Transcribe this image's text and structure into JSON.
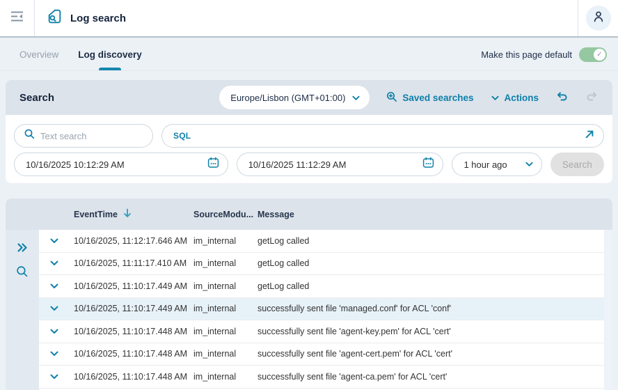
{
  "header": {
    "title": "Log search"
  },
  "tabs": [
    {
      "label": "Overview",
      "active": false
    },
    {
      "label": "Log discovery",
      "active": true
    }
  ],
  "page_default_toggle": {
    "label": "Make this page default",
    "state": "on",
    "check_glyph": "✓"
  },
  "search_panel": {
    "title": "Search",
    "timezone": "Europe/Lisbon (GMT+01:00)",
    "saved_searches_label": "Saved searches",
    "actions_label": "Actions",
    "text_search_placeholder": "Text search",
    "sql_label": "SQL",
    "start_time": "10/16/2025 10:12:29 AM",
    "end_time": "10/16/2025 11:12:29 AM",
    "relative_time": "1 hour ago",
    "search_button_label": "Search",
    "search_button_enabled": false
  },
  "table": {
    "columns": [
      {
        "label": "EventTime",
        "sorted": "desc"
      },
      {
        "label": "SourceModu..."
      },
      {
        "label": "Message"
      }
    ],
    "rows": [
      {
        "time": "10/16/2025, 11:12:17.646 AM",
        "source": "im_internal",
        "message": "getLog called",
        "highlighted": false
      },
      {
        "time": "10/16/2025, 11:11:17.410 AM",
        "source": "im_internal",
        "message": "getLog called",
        "highlighted": false
      },
      {
        "time": "10/16/2025, 11:10:17.449 AM",
        "source": "im_internal",
        "message": "getLog called",
        "highlighted": false
      },
      {
        "time": "10/16/2025, 11:10:17.449 AM",
        "source": "im_internal",
        "message": "successfully sent file 'managed.conf' for ACL 'conf'",
        "highlighted": true
      },
      {
        "time": "10/16/2025, 11:10:17.448 AM",
        "source": "im_internal",
        "message": "successfully sent file 'agent-key.pem' for ACL 'cert'",
        "highlighted": false
      },
      {
        "time": "10/16/2025, 11:10:17.448 AM",
        "source": "im_internal",
        "message": "successfully sent file 'agent-cert.pem' for ACL 'cert'",
        "highlighted": false
      },
      {
        "time": "10/16/2025, 11:10:17.448 AM",
        "source": "im_internal",
        "message": "successfully sent file 'agent-ca.pem' for ACL 'cert'",
        "highlighted": false
      }
    ]
  },
  "colors": {
    "accent": "#0e7ea8",
    "link": "#0d7fa9",
    "toggle_on": "#95c8a0",
    "row_highlight": "#e7f2f8",
    "panel_header": "#dce3eb",
    "disabled_button_bg": "#e1e1e1",
    "page_background": "#ecf1f6"
  }
}
